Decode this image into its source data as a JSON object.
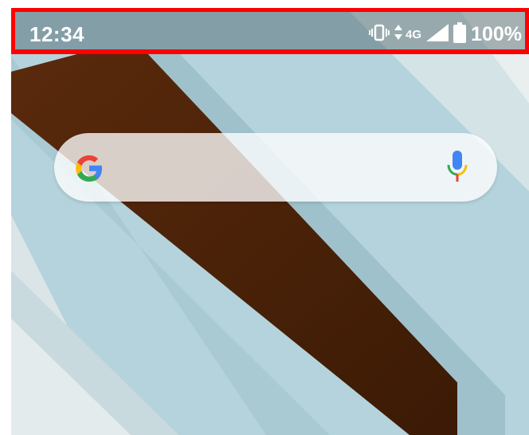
{
  "status_bar": {
    "time": "12:34",
    "network": "4G",
    "battery": "100%",
    "icons": [
      "vibrate-icon",
      "data-arrows-icon",
      "signal-icon",
      "battery-icon"
    ]
  },
  "search_widget": {
    "icons": [
      "google-logo-icon",
      "microphone-icon"
    ]
  },
  "colors": {
    "highlight_border": "#ff0000",
    "wallpaper_blue": "#b5d3dc",
    "wallpaper_brown": "#4a2208"
  }
}
